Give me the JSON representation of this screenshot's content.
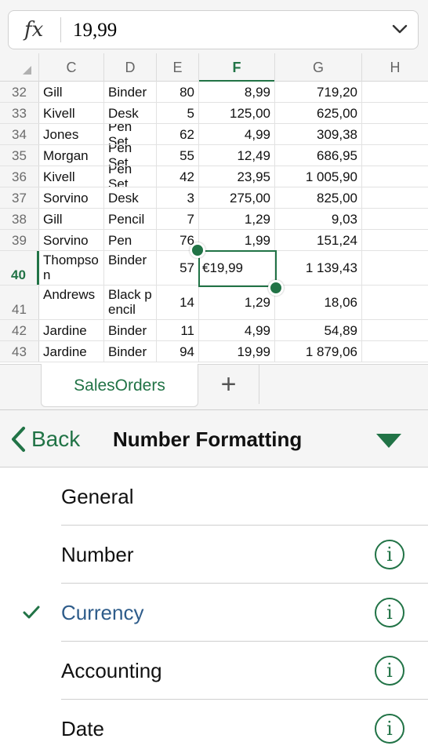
{
  "formula_bar": {
    "fx_label": "fx",
    "value": "19,99"
  },
  "columns": [
    "C",
    "D",
    "E",
    "F",
    "G",
    "H"
  ],
  "active_column": "F",
  "rows": [
    {
      "n": "32",
      "c": "Gill",
      "d": "Binder",
      "e": "80",
      "f": "8,99",
      "g": "719,20"
    },
    {
      "n": "33",
      "c": "Kivell",
      "d": "Desk",
      "e": "5",
      "f": "125,00",
      "g": "625,00"
    },
    {
      "n": "34",
      "c": "Jones",
      "d": "Pen Set",
      "e": "62",
      "f": "4,99",
      "g": "309,38"
    },
    {
      "n": "35",
      "c": "Morgan",
      "d": "Pen Set",
      "e": "55",
      "f": "12,49",
      "g": "686,95"
    },
    {
      "n": "36",
      "c": "Kivell",
      "d": "Pen Set",
      "e": "42",
      "f": "23,95",
      "g": "1 005,90"
    },
    {
      "n": "37",
      "c": "Sorvino",
      "d": "Desk",
      "e": "3",
      "f": "275,00",
      "g": "825,00"
    },
    {
      "n": "38",
      "c": "Gill",
      "d": "Pencil",
      "e": "7",
      "f": "1,29",
      "g": "9,03"
    },
    {
      "n": "39",
      "c": "Sorvino",
      "d": "Pen",
      "e": "76",
      "f": "1,99",
      "g": "151,24"
    },
    {
      "n": "40",
      "c": "Thompson",
      "d": "Binder",
      "e": "57",
      "f": "€19,99",
      "g": "1 139,43"
    },
    {
      "n": "41",
      "c": "Andrews",
      "d": "Black pencil",
      "e": "14",
      "f": "1,29",
      "g": "18,06"
    },
    {
      "n": "42",
      "c": "Jardine",
      "d": "Binder",
      "e": "11",
      "f": "4,99",
      "g": "54,89"
    },
    {
      "n": "43",
      "c": "Jardine",
      "d": "Binder",
      "e": "94",
      "f": "19,99",
      "g": "1 879,06"
    }
  ],
  "active_row": "40",
  "sheet_tabs": {
    "active": "SalesOrders",
    "add_label": "+"
  },
  "panel": {
    "back_label": "Back",
    "title": "Number Formatting",
    "items": [
      {
        "label": "General",
        "selected": false,
        "info": false
      },
      {
        "label": "Number",
        "selected": false,
        "info": true
      },
      {
        "label": "Currency",
        "selected": true,
        "info": true
      },
      {
        "label": "Accounting",
        "selected": false,
        "info": true
      },
      {
        "label": "Date",
        "selected": false,
        "info": true
      }
    ],
    "info_glyph": "i"
  },
  "colors": {
    "accent": "#217346",
    "selected_text": "#2e5c8a"
  },
  "icons": [
    "chevron-down-icon",
    "back-chevron-icon",
    "dropdown-triangle-icon",
    "checkmark-icon",
    "info-icon",
    "plus-icon"
  ]
}
